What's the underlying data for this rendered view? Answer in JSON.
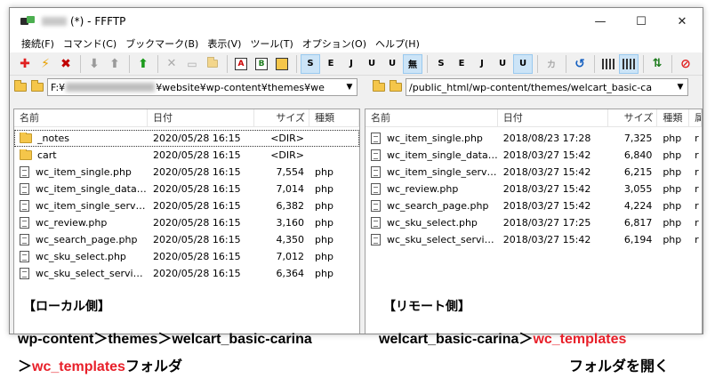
{
  "window": {
    "title": "(*) - FFFTP",
    "controls": {
      "minimize": "—",
      "maximize": "☐",
      "close": "✕"
    }
  },
  "menu": [
    "接続(F)",
    "コマンド(C)",
    "ブックマーク(B)",
    "表示(V)",
    "ツール(T)",
    "オプション(O)",
    "ヘルプ(H)"
  ],
  "toolbar": {
    "ascii": "A",
    "binary": "B",
    "kana_buttons": [
      "S",
      "E",
      "J",
      "U",
      "U",
      "無"
    ],
    "kana_buttons2": [
      "S",
      "E",
      "J",
      "U",
      "U"
    ],
    "kana": "カ"
  },
  "local": {
    "path_prefix": "F:¥",
    "path_suffix": "¥website¥wp-content¥themes¥we",
    "columns": {
      "name": "名前",
      "date": "日付",
      "size": "サイズ",
      "type": "種類"
    },
    "rows": [
      {
        "name": "_notes",
        "date": "2020/05/28 16:15",
        "size": "<DIR>",
        "type": "",
        "kind": "folder"
      },
      {
        "name": "cart",
        "date": "2020/05/28 16:15",
        "size": "<DIR>",
        "type": "",
        "kind": "folder"
      },
      {
        "name": "wc_item_single.php",
        "date": "2020/05/28 16:15",
        "size": "7,554",
        "type": "php",
        "kind": "file"
      },
      {
        "name": "wc_item_single_data.p...",
        "date": "2020/05/28 16:15",
        "size": "7,014",
        "type": "php",
        "kind": "file"
      },
      {
        "name": "wc_item_single_servic...",
        "date": "2020/05/28 16:15",
        "size": "6,382",
        "type": "php",
        "kind": "file"
      },
      {
        "name": "wc_review.php",
        "date": "2020/05/28 16:15",
        "size": "3,160",
        "type": "php",
        "kind": "file"
      },
      {
        "name": "wc_search_page.php",
        "date": "2020/05/28 16:15",
        "size": "4,350",
        "type": "php",
        "kind": "file"
      },
      {
        "name": "wc_sku_select.php",
        "date": "2020/05/28 16:15",
        "size": "7,012",
        "type": "php",
        "kind": "file"
      },
      {
        "name": "wc_sku_select_service...",
        "date": "2020/05/28 16:15",
        "size": "6,364",
        "type": "php",
        "kind": "file"
      }
    ],
    "label": "【ローカル側】"
  },
  "remote": {
    "path": "/public_html/wp-content/themes/welcart_basic-ca",
    "columns": {
      "name": "名前",
      "date": "日付",
      "size": "サイズ",
      "type": "種類",
      "extra": "属"
    },
    "rows": [
      {
        "name": "wc_item_single.php",
        "date": "2018/08/23 17:28",
        "size": "7,325",
        "type": "php",
        "extra": "r"
      },
      {
        "name": "wc_item_single_data.p...",
        "date": "2018/03/27 15:42",
        "size": "6,840",
        "type": "php",
        "extra": "r"
      },
      {
        "name": "wc_item_single_servic...",
        "date": "2018/03/27 15:42",
        "size": "6,215",
        "type": "php",
        "extra": "r"
      },
      {
        "name": "wc_review.php",
        "date": "2018/03/27 15:42",
        "size": "3,055",
        "type": "php",
        "extra": "r"
      },
      {
        "name": "wc_search_page.php",
        "date": "2018/03/27 15:42",
        "size": "4,224",
        "type": "php",
        "extra": "r"
      },
      {
        "name": "wc_sku_select.php",
        "date": "2018/03/27 17:25",
        "size": "6,817",
        "type": "php",
        "extra": "r"
      },
      {
        "name": "wc_sku_select_service...",
        "date": "2018/03/27 15:42",
        "size": "6,194",
        "type": "php",
        "extra": "r"
      }
    ],
    "label": "【リモート側】"
  },
  "captions": {
    "left_line1": "wp-content＞themes＞welcart_basic-carina",
    "left_line2_prefix": "＞",
    "left_line2_red": "wc_templates",
    "left_line2_suffix": "フォルダ",
    "right_line1_black": "welcart_basic-carina＞",
    "right_line1_red": "wc_templates",
    "right_line2": "フォルダを開く"
  },
  "colors": {
    "accent_red": "#e8202a",
    "folder": "#f5c64a"
  }
}
